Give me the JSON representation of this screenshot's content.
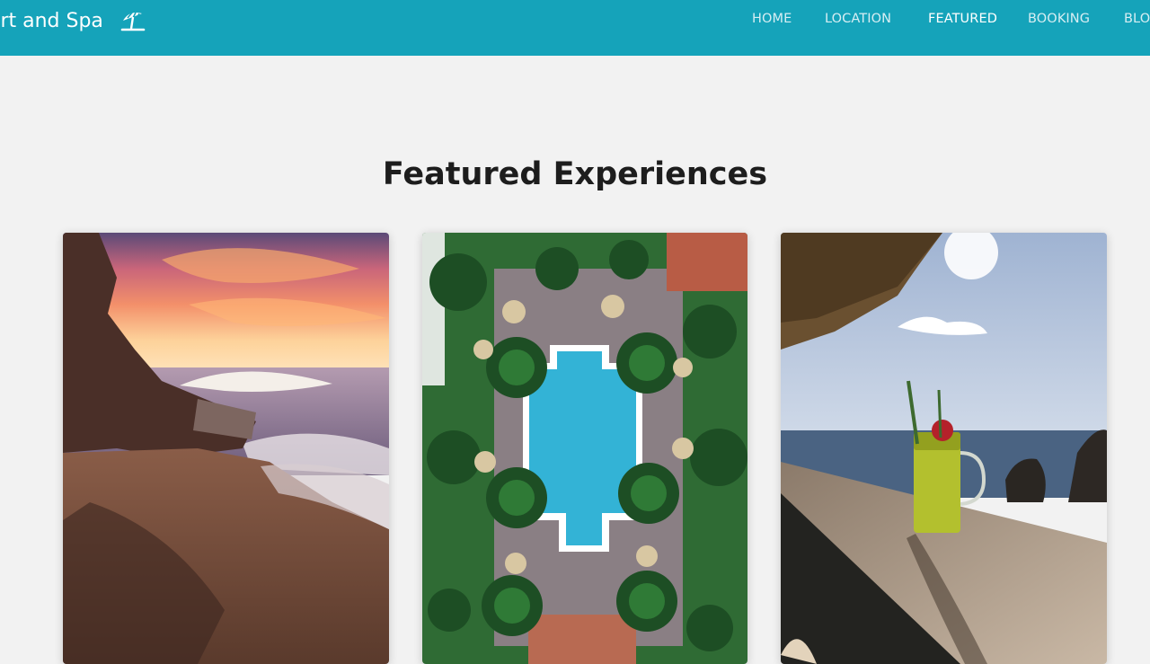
{
  "header": {
    "brand": "esort and Spa",
    "brand_icon": "beach-umbrella-icon",
    "nav": [
      {
        "label": "HOME",
        "active": false
      },
      {
        "label": "LOCATION",
        "active": false
      },
      {
        "label": "FEATURED",
        "active": true
      },
      {
        "label": "BOOKING",
        "active": false
      },
      {
        "label": "BLO",
        "active": false
      }
    ]
  },
  "featured": {
    "title": "Featured Experiences",
    "cards": [
      {
        "image": "sunset-cliff-seaside"
      },
      {
        "image": "aerial-pool-palms"
      },
      {
        "image": "cocktail-on-beach-deck"
      }
    ]
  },
  "colors": {
    "header_bg": "#15a3ba",
    "page_bg": "#f2f2f2",
    "nav_active": "#ffffff",
    "nav_inactive": "#d7eef3"
  }
}
